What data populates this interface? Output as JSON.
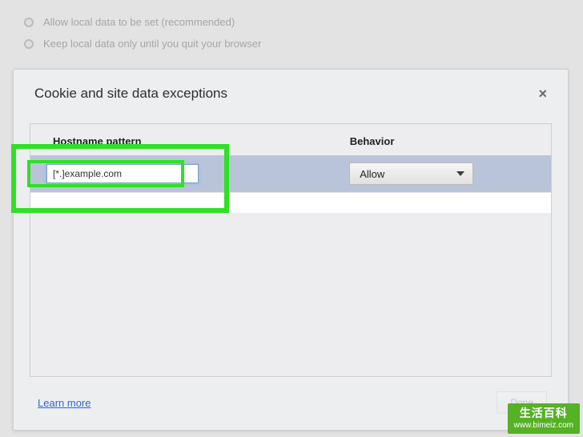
{
  "background": {
    "options": [
      "Allow local data to be set (recommended)",
      "Keep local data only until you quit your browser"
    ]
  },
  "dialog": {
    "title": "Cookie and site data exceptions",
    "close_glyph": "×",
    "columns": {
      "hostname": "Hostname pattern",
      "behavior": "Behavior"
    },
    "row": {
      "hostname_value": "[*.]example.com",
      "behavior_value": "Allow"
    },
    "footer": {
      "learn_more": "Learn more",
      "done": "Done"
    }
  },
  "watermark": {
    "title": "生活百科",
    "url": "www.bimeiz.com"
  }
}
